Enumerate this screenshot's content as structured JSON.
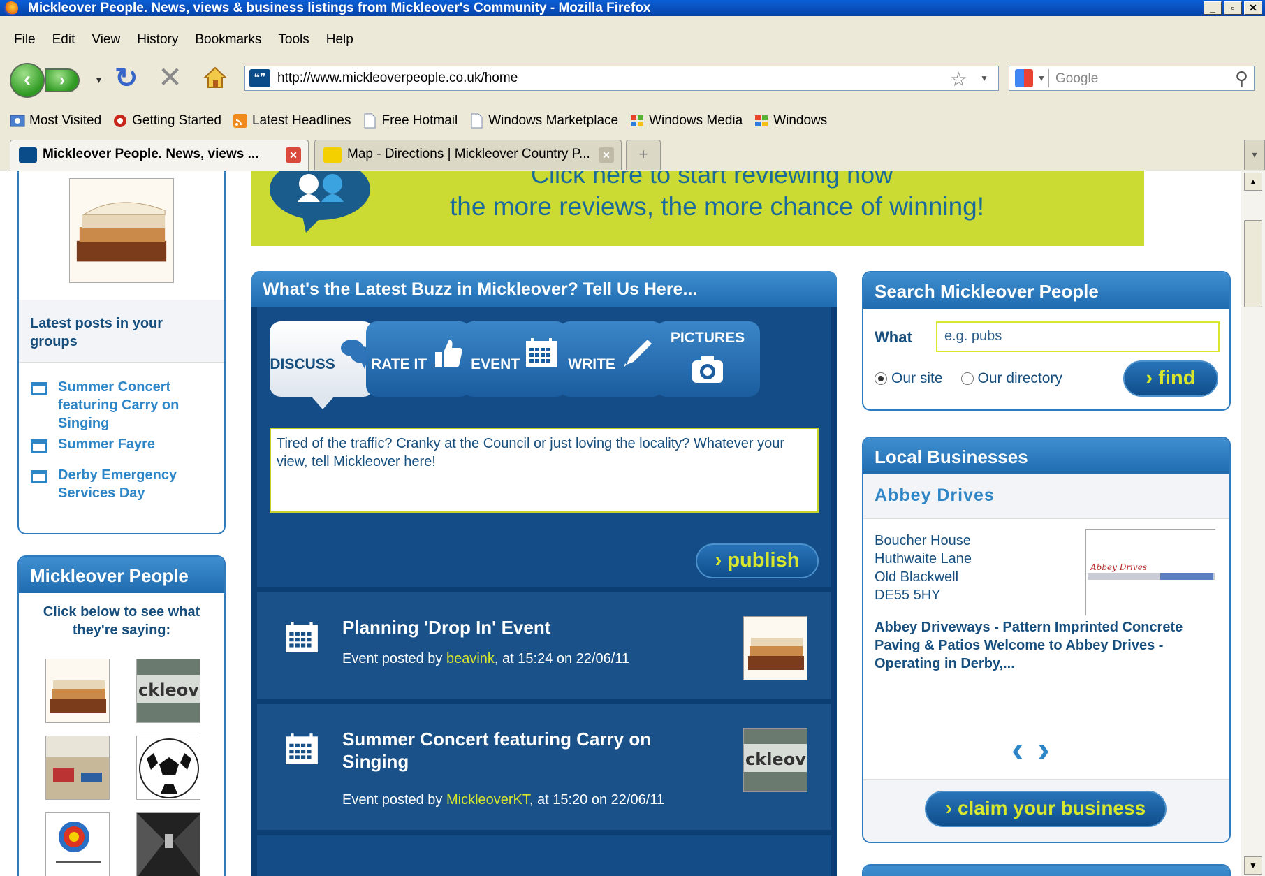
{
  "window": {
    "title": "Mickleover People. News, views & business listings from Mickleover's Community - Mozilla Firefox",
    "buttons": {
      "minimize": "_",
      "maximize": "▫",
      "close": "✕"
    }
  },
  "menu": [
    "File",
    "Edit",
    "View",
    "History",
    "Bookmarks",
    "Tools",
    "Help"
  ],
  "nav": {
    "url": "http://www.mickleoverpeople.co.uk/home",
    "search_placeholder": "Google"
  },
  "bookmarks": [
    {
      "label": "Most Visited",
      "icon": "most-visited-icon"
    },
    {
      "label": "Getting Started",
      "icon": "firefox-icon"
    },
    {
      "label": "Latest Headlines",
      "icon": "rss-icon"
    },
    {
      "label": "Free Hotmail",
      "icon": "page-icon"
    },
    {
      "label": "Windows Marketplace",
      "icon": "page-icon"
    },
    {
      "label": "Windows Media",
      "icon": "windows-icon"
    },
    {
      "label": "Windows",
      "icon": "windows-icon"
    }
  ],
  "tabs": [
    {
      "label": "Mickleover People. News, views ...",
      "active": true
    },
    {
      "label": "Map - Directions | Mickleover Country P...",
      "active": false
    }
  ],
  "banner": {
    "line1": "Click here to start reviewing now",
    "line2": "the more reviews, the more chance of winning!",
    "colors": {
      "background": "#ccdb33",
      "text": "#1b6a9c"
    }
  },
  "groups": {
    "heading": "Latest posts in your groups",
    "items": [
      "Summer Concert featuring Carry on Singing",
      "Summer Fayre",
      "Derby Emergency Services Day"
    ]
  },
  "people": {
    "heading": "Mickleover People",
    "subtitle": "Click below to see what they're saying:",
    "thumbnails": [
      "books",
      "mickleover-sign",
      "gym",
      "football",
      "archery",
      "street"
    ]
  },
  "buzz": {
    "heading": "What's the Latest Buzz in Mickleover? Tell Us Here...",
    "tabs": [
      {
        "label": "DISCUSS",
        "icon": "speech-bubbles-icon",
        "active": true
      },
      {
        "label": "RATE IT",
        "icon": "thumbs-up-icon",
        "active": false
      },
      {
        "label": "EVENT",
        "icon": "calendar-icon",
        "active": false
      },
      {
        "label": "WRITE",
        "icon": "pen-icon",
        "active": false
      },
      {
        "label": "PICTURES",
        "icon": "camera-icon",
        "active": false
      }
    ],
    "input_placeholder": "Tired of the traffic? Cranky at the Council or just loving the locality? Whatever your view, tell Mickleover here!",
    "publish_label": "publish",
    "posts": [
      {
        "title": "Planning 'Drop In' Event",
        "meta_prefix": "Event posted by ",
        "user": "beavink",
        "meta_suffix": ", at 15:24 on 22/06/11"
      },
      {
        "title": "Summer Concert featuring Carry on Singing",
        "meta_prefix": "Event posted by ",
        "user": "MickleoverKT",
        "meta_suffix": ", at 15:20 on 22/06/11"
      }
    ],
    "colors": {
      "panel": "#0b3f73",
      "accent": "#d9e62e"
    }
  },
  "search": {
    "heading": "Search Mickleover People",
    "what_label": "What",
    "what_placeholder": "e.g. pubs",
    "options": [
      {
        "label": "Our site",
        "checked": true
      },
      {
        "label": "Our directory",
        "checked": false
      }
    ],
    "find_label": "find"
  },
  "business": {
    "heading": "Local Businesses",
    "name": "Abbey Drives",
    "address": [
      "Boucher House",
      "Huthwaite Lane",
      "Old Blackwell",
      "DE55 5HY"
    ],
    "logo_text": "Abbey Drives",
    "description": "Abbey Driveways - Pattern Imprinted Concrete Paving & Patios Welcome to Abbey Drives - Operating in Derby,...",
    "claim_label": "claim your business"
  }
}
